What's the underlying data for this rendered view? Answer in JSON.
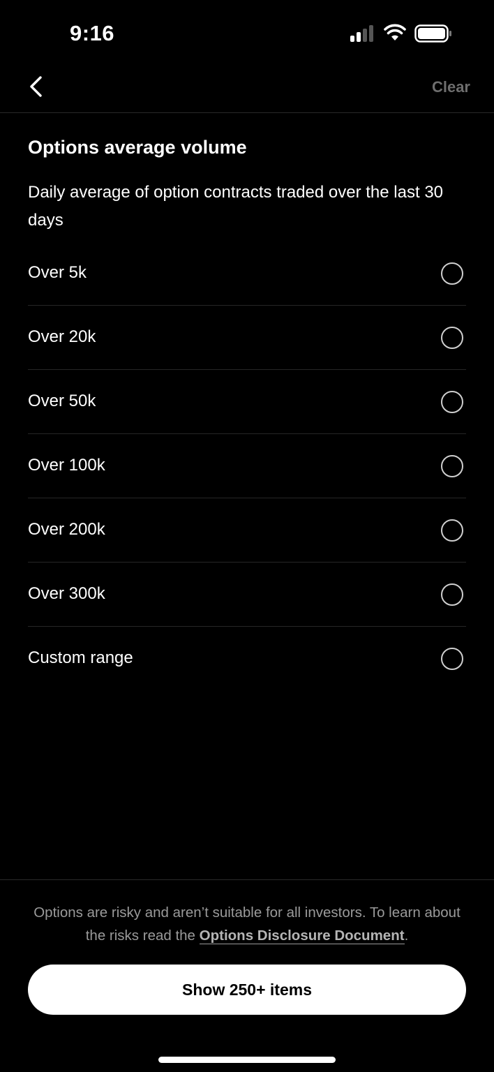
{
  "status_bar": {
    "time": "9:16",
    "icons": [
      "signal-icon",
      "wifi-icon",
      "battery-icon"
    ]
  },
  "nav": {
    "back_icon": "chevron-left-icon",
    "clear_label": "Clear"
  },
  "section": {
    "title": "Options average volume",
    "description": "Daily average of option contracts traded over the last 30 days"
  },
  "options": [
    {
      "label": "Over 5k",
      "selected": false
    },
    {
      "label": "Over 20k",
      "selected": false
    },
    {
      "label": "Over 50k",
      "selected": false
    },
    {
      "label": "Over 100k",
      "selected": false
    },
    {
      "label": "Over 200k",
      "selected": false
    },
    {
      "label": "Over 300k",
      "selected": false
    },
    {
      "label": "Custom range",
      "selected": false
    }
  ],
  "footer": {
    "disclaimer_prefix": "Options are risky and aren’t suitable for all investors. To learn about the risks read the ",
    "disclosure_link": "Options Disclosure Document",
    "disclaimer_suffix": ".",
    "show_button_label": "Show 250+ items"
  },
  "colors": {
    "background": "#000000",
    "text": "#ffffff",
    "muted": "#6e6e6e",
    "button_bg": "#ffffff"
  }
}
